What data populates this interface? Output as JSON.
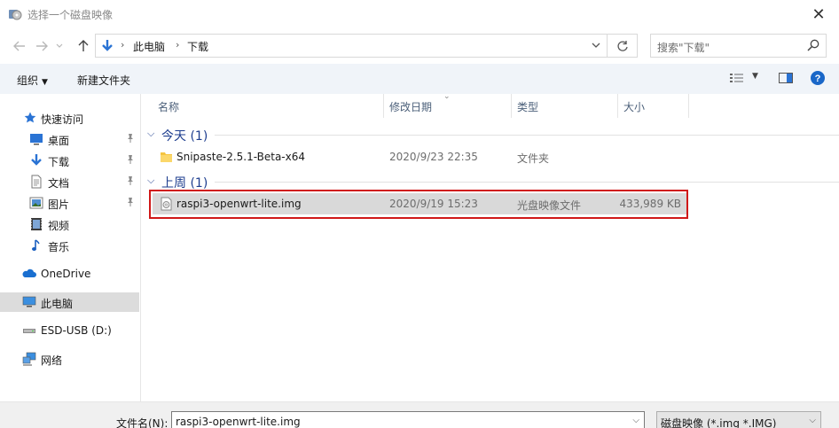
{
  "window": {
    "title": "选择一个磁盘映像",
    "close_glyph": "✕"
  },
  "address": {
    "crumbs": [
      "此电脑",
      "下载"
    ],
    "search_placeholder": "搜索\"下载\""
  },
  "toolbar": {
    "organize_label": "组织",
    "new_folder_label": "新建文件夹"
  },
  "nav": {
    "quick_access": "快速访问",
    "items": [
      {
        "label": "桌面",
        "icon": "desktop-icon",
        "pinned": true
      },
      {
        "label": "下载",
        "icon": "download-icon",
        "pinned": true
      },
      {
        "label": "文档",
        "icon": "document-icon",
        "pinned": true
      },
      {
        "label": "图片",
        "icon": "picture-icon",
        "pinned": true
      },
      {
        "label": "视频",
        "icon": "video-icon",
        "pinned": false
      },
      {
        "label": "音乐",
        "icon": "music-icon",
        "pinned": false
      }
    ],
    "onedrive": "OneDrive",
    "this_pc": "此电脑",
    "usb": "ESD-USB (D:)",
    "network": "网络"
  },
  "columns": {
    "name": "名称",
    "date": "修改日期",
    "type": "类型",
    "size": "大小"
  },
  "groups": [
    {
      "label": "今天 (1)",
      "files": [
        {
          "name": "Snipaste-2.5.1-Beta-x64",
          "date": "2020/9/23 22:35",
          "type": "文件夹",
          "size": "",
          "icon": "folder-icon"
        }
      ]
    },
    {
      "label": "上周 (1)",
      "files": [
        {
          "name": "raspi3-openwrt-lite.img",
          "date": "2020/9/19 15:23",
          "type": "光盘映像文件",
          "size": "433,989 KB",
          "icon": "disc-image-file-icon"
        }
      ]
    }
  ],
  "bottom": {
    "filename_label": "文件名(N):",
    "filename_value": "raspi3-openwrt-lite.img",
    "filetype_value": "磁盘映像 (*.img *.IMG)"
  },
  "colors": {
    "accent_blue": "#1e3e8f",
    "highlight_box": "#d01818",
    "selection": "#d9d9d9",
    "toolbar_bg": "#f0f4f9"
  }
}
